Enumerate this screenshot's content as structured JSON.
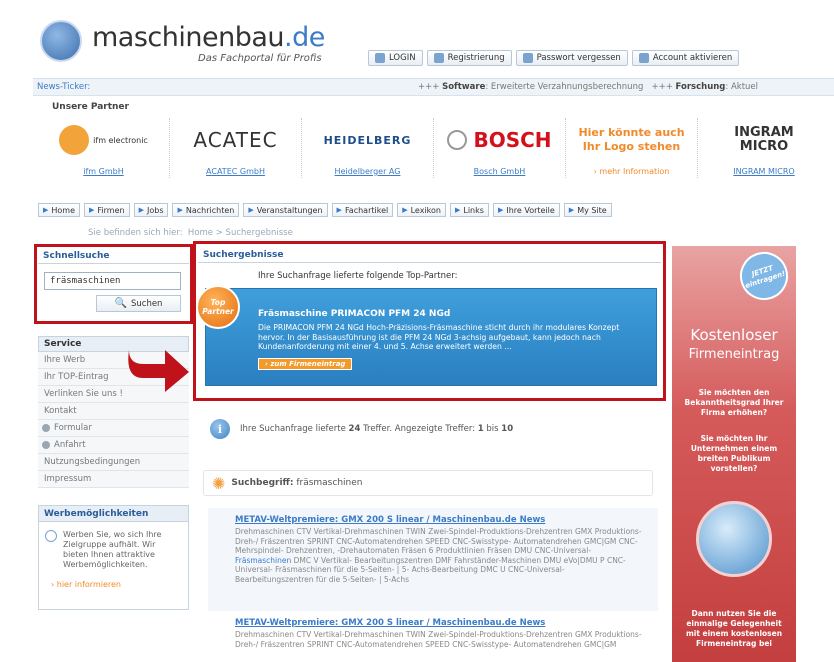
{
  "header": {
    "logo_main": "maschinenbau",
    "logo_tld": ".de",
    "tagline": "Das Fachportal für Profis",
    "tabs": [
      "LOGIN",
      "Registrierung",
      "Passwort vergessen",
      "Account aktivieren"
    ]
  },
  "news": {
    "label": "News-Ticker:",
    "items": [
      {
        "prefix": "+++",
        "title": "Software",
        "text": ": Erweiterte Verzahnungsberechnung"
      },
      {
        "prefix": "+++",
        "title": "Forschung",
        "text": ": Aktuel"
      }
    ]
  },
  "partners": {
    "title": "Unsere Partner",
    "items": [
      {
        "logo": "ifm electronic",
        "name": "ifm GmbH"
      },
      {
        "logo": "ACATEC",
        "name": "ACATEC GmbH"
      },
      {
        "logo": "HEIDELBERG",
        "name": "Heidelberger AG"
      },
      {
        "logo": "BOSCH",
        "name": "Bosch GmbH"
      },
      {
        "logo": "Hier könnte auch Ihr Logo stehen",
        "name": "› mehr Information"
      },
      {
        "logo": "INGRAM MICRO",
        "name": "INGRAM MICRO"
      }
    ]
  },
  "nav": [
    "Home",
    "Firmen",
    "Jobs",
    "Nachrichten",
    "Veranstaltungen",
    "Fachartikel",
    "Lexikon",
    "Links",
    "Ihre Vorteile",
    "My Site"
  ],
  "breadcrumb": {
    "prefix": "Sie befinden sich hier:",
    "path": "Home  >  Suchergebnisse"
  },
  "sidebar": {
    "quicksearch_title": "Schnellsuche",
    "search_value": "fräsmaschinen",
    "search_button": "Suchen",
    "service_title": "Service",
    "service_items": [
      "Ihre Werb",
      "Ihr TOP-Eintrag",
      "Verlinken Sie uns !",
      "Kontakt",
      "Formular",
      "Anfahrt",
      "Nutzungsbedingungen",
      "Impressum"
    ],
    "ads_title": "Werbemöglichkeiten",
    "ads_text": "Werben Sie, wo sich Ihre Zielgruppe aufhält. Wir bieten Ihnen attraktive Werbemöglichkeiten.",
    "ads_link": "› hier informieren"
  },
  "results": {
    "title": "Suchergebnisse",
    "intro": "Ihre Suchanfrage lieferte folgende Top-Partner:",
    "badge": "Top Partner",
    "top_title": "Fräsmaschine PRIMACON PFM 24 NGd",
    "top_text": "Die PRIMACON PFM 24 NGd Hoch-Präzisions-Fräsmaschine sticht durch ihr modulares Konzept hervor. In der Basisausführung ist die PFM 24 NGd 3-achsig aufgebaut, kann jedoch nach Kundenanforderung mit einer 4. und 5. Achse erweitert werden ...",
    "top_button": "› zum Firmeneintrag",
    "count_text_a": "Ihre Suchanfrage lieferte",
    "count": "24",
    "count_text_b": "Treffer. Angezeigte Treffer:",
    "range_from": "1",
    "range_to": "10",
    "term_label": "Suchbegriff:",
    "term": "fräsmaschinen",
    "hits": [
      {
        "title": "METAV-Weltpremiere: GMX 200 S linear / Maschinenbau.de News",
        "text_a": "Drehmaschinen CTV Vertikal-Drehmaschinen TWIN Zwei-Spindel-Produktions-Drehzentren GMX Produktions-Dreh-/ Fräszentren SPRINT CNC-Automatendrehen SPEED CNC-Swisstype- Automatendrehen GMC|GM CNC-Mehrspindel- Drehzentren, -Drehautomaten Fräsen 6 Produktlinien Fräsen DMU CNC-Universal-",
        "highlight": "Fräsmaschinen",
        "text_b": "DMC V Vertikal- Bearbeitungszentren DMF Fahrständer-Maschinen DMU eVo|DMU P CNC-Universal- Fräsmaschinen für die 5-Seiten- | 5- Achs-Bearbeitung DMC U CNC-Universal- Bearbeitungszentren für die 5-Seiten- | 5-Achs"
      },
      {
        "title": "METAV-Weltpremiere: GMX 200 S linear / Maschinenbau.de News",
        "text_a": "Drehmaschinen CTV Vertikal-Drehmaschinen TWIN Zwei-Spindel-Produktions-Drehzentren GMX Produktions-Dreh-/ Fräszentren SPRINT CNC-Automatendrehen SPEED CNC-Swisstype- Automatendrehen GMC|GM",
        "highlight": "",
        "text_b": ""
      }
    ]
  },
  "right_ad": {
    "badge": "JETZT eintragen!",
    "title": "Kostenloser",
    "subtitle": "Firmeneintrag",
    "q1": "Sie möchten den Bekanntheitsgrad Ihrer Firma erhöhen?",
    "q2": "Sie möchten Ihr Unternehmen einem breiten Publikum vorstellen?",
    "bottom": "Dann nutzen Sie die einmalige Gelegenheit mit einem kostenlosen Firmeneintrag bei"
  },
  "colors": {
    "accent": "#3b7bc8",
    "highlight_red": "#c0121a",
    "ad_red": "#c43f3f",
    "orange": "#e56d10"
  }
}
